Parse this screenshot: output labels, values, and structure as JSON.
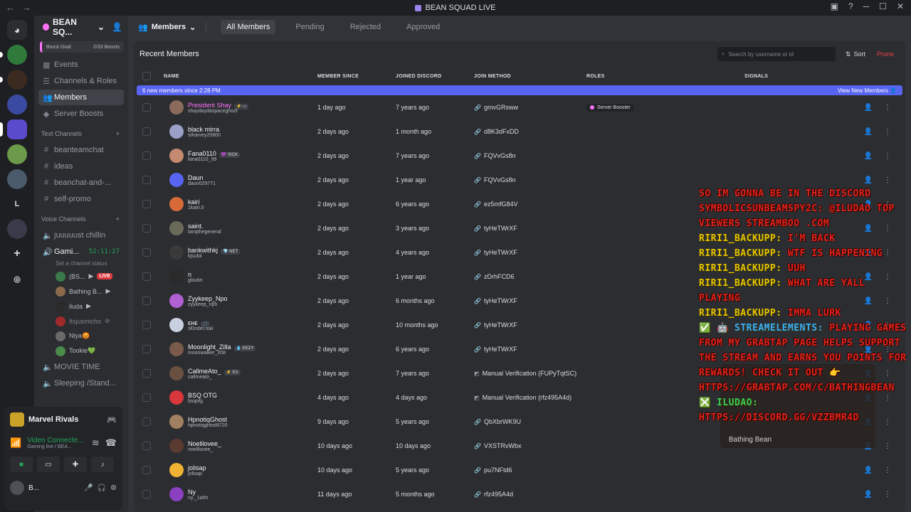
{
  "titlebar": {
    "title": "BEAN SQUAD LIVE"
  },
  "server": {
    "name": "BEAN SQ...",
    "boost_goal": "Boost Goal",
    "boost_count": "2/33 Boosts",
    "nav": [
      "Events",
      "Channels & Roles",
      "Members",
      "Server Boosts"
    ],
    "text_category": "Text Channels",
    "text_channels": [
      "beanteamchat",
      "ideas",
      "beanchat-and-...",
      "self-promo"
    ],
    "voice_category": "Voice Channels",
    "voice_channels": [
      "juuuuust chillin",
      "Gami..."
    ],
    "gaming_timer": "52:11:27",
    "channel_status": "Set a channel status",
    "vc_users": [
      {
        "name": "(BS...",
        "live": "LIVE"
      },
      {
        "name": "Bathing B..."
      },
      {
        "name": "iluda"
      },
      {
        "name": "Itsjusmicho"
      },
      {
        "name": "Niya😡"
      },
      {
        "name": "Tookie💚"
      }
    ],
    "other_channels": [
      "MOVIE TIME",
      "Sleeping /Stand..."
    ]
  },
  "panel": {
    "game": "Marvel Rivals",
    "video": "Video Connecte...",
    "video_sub": "Gaming live / BEA...",
    "user": "B..."
  },
  "main": {
    "header": "Members",
    "tabs": [
      "All Members",
      "Pending",
      "Rejected",
      "Approved"
    ],
    "card_title": "Recent Members",
    "search_placeholder": "Search by username or id",
    "sort": "Sort",
    "prune": "Prune",
    "columns": [
      "NAME",
      "MEMBER SINCE",
      "JOINED DISCORD",
      "JOIN METHOD",
      "ROLES",
      "SIGNALS"
    ],
    "banner_text": "6 new members since 2:28 PM",
    "banner_action": "View New Members"
  },
  "members": [
    {
      "name": "President Shay",
      "tag": "⚡~♪",
      "user": "shaydaydaspaceghozt",
      "since": "1 day ago",
      "joined": "7 years ago",
      "method": "gmvGRsww",
      "role": "Server Booster",
      "color": "#8a6a5a",
      "namecolor": "#ff73fa"
    },
    {
      "name": "black mirra",
      "tag": "",
      "user": "stharvey20800",
      "since": "2 days ago",
      "joined": "1 month ago",
      "method": "d8K3dFxDD",
      "role": "",
      "color": "#9aa0c8"
    },
    {
      "name": "Fana0110",
      "tag": "💜 SICK",
      "user": "fana0110_99",
      "since": "2 days ago",
      "joined": "7 years ago",
      "method": "FQVvGs8n",
      "role": "",
      "color": "#c48a70"
    },
    {
      "name": "Daun",
      "tag": "",
      "user": "daun029771",
      "since": "2 days ago",
      "joined": "1 year ago",
      "method": "FQVvGs8n",
      "role": "",
      "color": "#5865f2"
    },
    {
      "name": "kairi",
      "tag": "",
      "user": "1kairi.0",
      "since": "2 days ago",
      "joined": "6 years ago",
      "method": "ez5mfG84V",
      "role": "",
      "color": "#d86a3a"
    },
    {
      "name": "saint.",
      "tag": "",
      "user": "tanqthegeneral",
      "since": "2 days ago",
      "joined": "3 years ago",
      "method": "tyHeTWrXF",
      "role": "",
      "color": "#6a6a5a"
    },
    {
      "name": "bankwithkj",
      "tag": "💎 NET",
      "user": "kjsubii",
      "since": "2 days ago",
      "joined": "4 years ago",
      "method": "tyHeTWrXF",
      "role": "",
      "color": "#3a3a3a"
    },
    {
      "name": "n",
      "tag": "",
      "user": "gloutin",
      "since": "2 days ago",
      "joined": "1 year ago",
      "method": "zDrhFCD6",
      "role": "",
      "color": "#2a2a2a"
    },
    {
      "name": "Zyykeep_Npo",
      "tag": "",
      "user": "zyykeep_npo",
      "since": "2 days ago",
      "joined": "6 months ago",
      "method": "tyHeTWrXF",
      "role": "",
      "color": "#b060d0"
    },
    {
      "name": "ᴇʜᴇ",
      "tag": "🎵",
      "user": "sl0nder.naii",
      "since": "2 days ago",
      "joined": "10 months ago",
      "method": "tyHeTWrXF",
      "role": "",
      "color": "#c8d0e0"
    },
    {
      "name": "Moonlight_Zilla",
      "tag": "💧 EEZY",
      "user": "moonwalker_z08",
      "since": "2 days ago",
      "joined": "6 years ago",
      "method": "tyHeTWrXF",
      "role": "",
      "color": "#7a5a4a"
    },
    {
      "name": "CallmeAto_",
      "tag": "⚡ EX",
      "user": "callmeato_",
      "since": "2 days ago",
      "joined": "7 years ago",
      "method": "Manual Verification (FUPyTqtSC)",
      "role": "",
      "color": "#6a5040"
    },
    {
      "name": "BSQ OTG",
      "tag": "",
      "user": "bsqotg",
      "since": "4 days ago",
      "joined": "4 days ago",
      "method": "Manual Verification (rfz495A4d)",
      "role": "",
      "color": "#da373c"
    },
    {
      "name": "HpnotiqGhost",
      "tag": "",
      "user": "hpnotiqghost8720",
      "since": "9 days ago",
      "joined": "5 years ago",
      "method": "QbXbrWK9U",
      "role": "",
      "color": "#a08060"
    },
    {
      "name": "Noelilovee_",
      "tag": "",
      "user": "noelilovee_",
      "since": "10 days ago",
      "joined": "10 days ago",
      "method": "VXSTRvWbx",
      "role": "",
      "color": "#5a3a30"
    },
    {
      "name": "jolisap",
      "tag": "",
      "user": "jolisap",
      "since": "10 days ago",
      "joined": "5 years ago",
      "method": "pu7NFtd6",
      "role": "",
      "color": "#f0b232"
    },
    {
      "name": "Ny",
      "tag": "",
      "user": "ny._1ahh",
      "since": "11 days ago",
      "joined": "5 months ago",
      "method": "rfz495A4d",
      "role": "",
      "color": "#8a40c0"
    }
  ],
  "overlay": {
    "lines": [
      {
        "nick": "",
        "text": "SO IM GONNA BE IN THE DISCORD"
      },
      {
        "nick": "",
        "text": "SYMBOLICSUNBEAMSPY2C: @ILUDAO TOP VIEWERS STREAMBOO .COM"
      },
      {
        "nick": "RIRI1_BACKUPP:",
        "text": "I'M BACK"
      },
      {
        "nick": "RIRI1_BACKUPP:",
        "text": "WTF IS HAPPENING"
      },
      {
        "nick": "RIRI1_BACKUPP:",
        "text": "UUH"
      },
      {
        "nick": "RIRI1_BACKUPP:",
        "text": "WHAT ARE YALL PLAYING"
      },
      {
        "nick": "RIRI1_BACKUPP:",
        "text": "IMMA LURK"
      },
      {
        "nick": "✅ 🤖 STREAMELEMENTS:",
        "text": "PLAYING GAMES FROM MY GRABTAP PAGE HELPS SUPPORT THE STREAM AND EARNS YOU POINTS FOR REWARDS! CHECK IT OUT 👉 HTTPS://GRABTAP.COM/C/BATHINGBEAN"
      },
      {
        "nick": "❎ ILUDAO:",
        "text": "HTTPS://DISCORD.GG/VZZBMR4D"
      }
    ],
    "cam_label": "Bathing Bean"
  }
}
